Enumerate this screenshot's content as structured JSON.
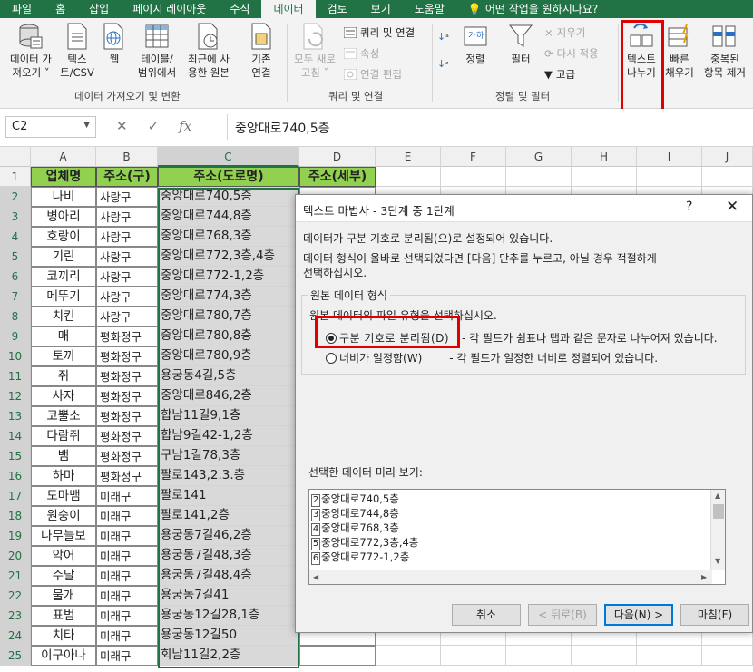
{
  "ribbon": {
    "tabs": [
      "파일",
      "홈",
      "삽입",
      "페이지 레이아웃",
      "수식",
      "데이터",
      "검토",
      "보기",
      "도움말"
    ],
    "active_tab": "데이터",
    "search": "어떤 작업을 원하시나요?",
    "get_data": {
      "btn1": [
        "데이터 가",
        "져오기 ˅"
      ],
      "btn2": [
        "텍스",
        "트/CSV"
      ],
      "btn3": [
        "웹"
      ],
      "btn4": [
        "테이블/",
        "범위에서"
      ],
      "btn5": [
        "최근에 사",
        "용한 원본"
      ],
      "btn6": [
        "기존",
        "연결"
      ],
      "label": "데이터 가져오기 및 변환"
    },
    "queries": {
      "refresh": [
        "모두 새로",
        "고침 ˅"
      ],
      "q1": "쿼리 및 연결",
      "q2": "속성",
      "q3": "연결 편집",
      "label": "쿼리 및 연결"
    },
    "sort": {
      "sort_btn": "정렬",
      "filter_btn": "필터",
      "clear": "지우기",
      "reapply": "다시 적용",
      "advanced": "고급",
      "label": "정렬 및 필터"
    },
    "tools": {
      "text_to_columns": [
        "텍스트",
        "나누기"
      ],
      "flash_fill": [
        "빠른",
        "채우기"
      ],
      "remove_dup": [
        "중복된",
        "항목 제거"
      ]
    }
  },
  "formula_bar": {
    "name_box": "C2",
    "formula": "중앙대로740,5층"
  },
  "sheet": {
    "columns": [
      "A",
      "B",
      "C",
      "D",
      "E",
      "F",
      "G",
      "H",
      "I",
      "J"
    ],
    "headers": [
      "업체명",
      "주소(구)",
      "주소(도로명)",
      "주소(세부)"
    ],
    "rows": [
      [
        "나비",
        "사랑구",
        "중앙대로740,5층"
      ],
      [
        "병아리",
        "사랑구",
        "중앙대로744,8층"
      ],
      [
        "호랑이",
        "사랑구",
        "중앙대로768,3층"
      ],
      [
        "기린",
        "사랑구",
        "중앙대로772,3층,4층"
      ],
      [
        "코끼리",
        "사랑구",
        "중앙대로772-1,2층"
      ],
      [
        "메뚜기",
        "사랑구",
        "중앙대로774,3층"
      ],
      [
        "치킨",
        "사랑구",
        "중앙대로780,7층"
      ],
      [
        "매",
        "평화정구",
        "중앙대로780,8층"
      ],
      [
        "토끼",
        "평화정구",
        "중앙대로780,9층"
      ],
      [
        "쥐",
        "평화정구",
        "용궁동4길,5층"
      ],
      [
        "사자",
        "평화정구",
        "중앙대로846,2층"
      ],
      [
        "코뿔소",
        "평화정구",
        "합남11길9,1층"
      ],
      [
        "다람쥐",
        "평화정구",
        "합남9길42-1,2층"
      ],
      [
        "뱀",
        "평화정구",
        "구남1길78,3층"
      ],
      [
        "하마",
        "평화정구",
        "팔로143,2.3.층"
      ],
      [
        "도마뱀",
        "미래구",
        "팔로141"
      ],
      [
        "원숭이",
        "미래구",
        "팔로141,2층"
      ],
      [
        "나무늘보",
        "미래구",
        "용궁동7길46,2층"
      ],
      [
        "악어",
        "미래구",
        "용궁동7길48,3층"
      ],
      [
        "수달",
        "미래구",
        "용궁동7길48,4층"
      ],
      [
        "물개",
        "미래구",
        "용궁동7길41"
      ],
      [
        "표범",
        "미래구",
        "용궁동12길28,1층"
      ],
      [
        "치타",
        "미래구",
        "용궁동12길50"
      ],
      [
        "이구아나",
        "미래구",
        "회남11길2,2층"
      ]
    ]
  },
  "dialog": {
    "title": "텍스트 마법사 - 3단계 중 1단계",
    "help": "?",
    "close": "✕",
    "line1": "데이터가 구분 기호로 분리됨(으)로 설정되어 있습니다.",
    "line2": "데이터 형식이 올바로 선택되었다면 [다음] 단추를 누르고, 아닐 경우 적절하게",
    "line3": "선택하십시오.",
    "group_label": "원본 데이터 형식",
    "group_desc": "원본 데이터의 파일 유형을 선택하십시오.",
    "opt1_label": "구분 기호로 분리됨(D)",
    "opt1_desc": "- 각 필드가 쉼표나 탭과 같은 문자로 나누어져 있습니다.",
    "opt2_label": "너비가 일정함(W)",
    "opt2_desc": "- 각 필드가 일정한 너비로 정렬되어 있습니다.",
    "preview_label": "선택한 데이터 미리 보기:",
    "preview_rows": [
      {
        "n": "2",
        "t": "중앙대로740,5층"
      },
      {
        "n": "3",
        "t": "중앙대로744,8층"
      },
      {
        "n": "4",
        "t": "중앙대로768,3층"
      },
      {
        "n": "5",
        "t": "중앙대로772,3층,4층"
      },
      {
        "n": "6",
        "t": "중앙대로772-1,2층"
      }
    ],
    "btn_cancel": "취소",
    "btn_back": "< 뒤로(B)",
    "btn_next": "다음(N) >",
    "btn_finish": "마침(F)"
  }
}
